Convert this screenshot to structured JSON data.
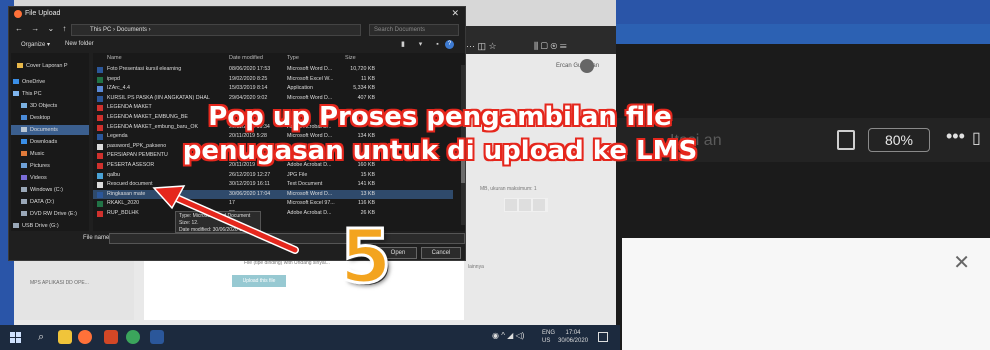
{
  "dialog": {
    "title": "File Upload",
    "path": "This PC  ›  Documents  ›",
    "search_placeholder": "Search Documents",
    "organize": "Organize ▾",
    "new_folder": "New folder",
    "columns": {
      "name": "Name",
      "date": "Date modified",
      "type": "Type",
      "size": "Size"
    },
    "nav_items": [
      {
        "label": "Cover Laporan P",
        "icon": "folder-icon"
      },
      {
        "label": "OneDrive",
        "icon": "cloud-icon"
      },
      {
        "label": "This PC",
        "icon": "computer-icon"
      },
      {
        "label": "3D Objects",
        "icon": "cube-icon"
      },
      {
        "label": "Desktop",
        "icon": "desktop-icon"
      },
      {
        "label": "Documents",
        "icon": "documents-icon"
      },
      {
        "label": "Downloads",
        "icon": "download-icon"
      },
      {
        "label": "Music",
        "icon": "music-icon"
      },
      {
        "label": "Pictures",
        "icon": "pictures-icon"
      },
      {
        "label": "Videos",
        "icon": "video-icon"
      },
      {
        "label": "Windows (C:)",
        "icon": "drive-icon"
      },
      {
        "label": "DATA (D:)",
        "icon": "drive-icon"
      },
      {
        "label": "DVD RW Drive (E:)",
        "icon": "dvd-icon"
      },
      {
        "label": "USB Drive (G:)",
        "icon": "usb-icon"
      }
    ],
    "files": [
      {
        "name": "Foto Presentasi kursil elearning",
        "date": "08/06/2020 17:53",
        "type": "Microsoft Word D...",
        "size": "10,720 KB",
        "icon": "word"
      },
      {
        "name": "ipepd",
        "date": "19/02/2020 8:25",
        "type": "Microsoft Excel W...",
        "size": "11 KB",
        "icon": "excel"
      },
      {
        "name": "IZArc_4.4",
        "date": "15/03/2019 8:14",
        "type": "Application",
        "size": "5,334 KB",
        "icon": "app"
      },
      {
        "name": "KURSIL PS PASKA (IIN ANGKATAN) DHAL",
        "date": "29/04/2020 9:02",
        "type": "Microsoft Word D...",
        "size": "407 KB",
        "icon": "word"
      },
      {
        "name": "LEGENDA MAKET",
        "date": "",
        "type": "",
        "size": "",
        "icon": "pdf"
      },
      {
        "name": "LEGENDA MAKET_EMBUNG_BE",
        "date": "",
        "type": "",
        "size": "",
        "icon": "pdf"
      },
      {
        "name": "LEGENDA MAKET_embung_baru_OK",
        "date": "20/11/2019 16:34",
        "type": "Adobe Acrobat D...",
        "size": "",
        "icon": "pdf"
      },
      {
        "name": "Legenda",
        "date": "20/11/2019 5:28",
        "type": "Microsoft Word D...",
        "size": "134 KB",
        "icon": "word"
      },
      {
        "name": "password_PPK_pakseno",
        "date": "",
        "type": "",
        "size": "",
        "icon": "text"
      },
      {
        "name": "PERSIAPAN PEMBENTU",
        "date": "",
        "type": "",
        "size": "",
        "icon": "pdf"
      },
      {
        "name": "PESERTA ASESOR",
        "date": "20/11/2019",
        "type": "Adobe Acrobat D...",
        "size": "160 KB",
        "icon": "pdf"
      },
      {
        "name": "qalbu",
        "date": "26/12/2019 12:27",
        "type": "JPG File",
        "size": "15 KB",
        "icon": "image"
      },
      {
        "name": "Rescued document",
        "date": "30/12/2019 16:11",
        "type": "Text Document",
        "size": "141 KB",
        "icon": "text"
      },
      {
        "name": "Ringkasan mate",
        "date": "30/06/2020 17:04",
        "type": "Microsoft Word D...",
        "size": "13 KB",
        "icon": "word"
      },
      {
        "name": "RKAKL_2020",
        "date": "17",
        "type": "Microsoft Excel 97...",
        "size": "116 KB",
        "icon": "excel"
      },
      {
        "name": "RUP_BDLHK",
        "date": "20",
        "type": "Adobe Acrobat D...",
        "size": "26 KB",
        "icon": "pdf"
      }
    ],
    "tooltip_line1": "Type: Microsoft Word Document",
    "tooltip_line2": "Size: 12.",
    "tooltip_line3": "Date modified: 30/06/2020 17:04",
    "filename_label": "File name:",
    "open_button": "Open",
    "cancel_button": "Cancel"
  },
  "annotation": {
    "line1": "Pop up Proses pengambilan file",
    "line2": "penugasan untuk di upload ke LMS",
    "step": "5"
  },
  "browser": {
    "user_name": "Ercan Gunawan",
    "upload_button": "Upload this file",
    "hint": "File (tipe dinding) with Undang sinyal...",
    "hint_right": "lainnya",
    "side_item": "MPS APLIKASI DD OPE...",
    "right_note": "MB, ukuran maksimum: 1"
  },
  "right_view": {
    "zoom": "80%",
    "faded_title": "Itasi an"
  },
  "taskbar": {
    "lang_top": "ENG",
    "lang_bottom": "US",
    "time": "17:04",
    "date": "30/06/2020"
  },
  "colors": {
    "annotation_outline": "#e5271d",
    "step_fill": "#f3a41f",
    "arrow": "#e5271d",
    "background": "#2a55a8"
  }
}
